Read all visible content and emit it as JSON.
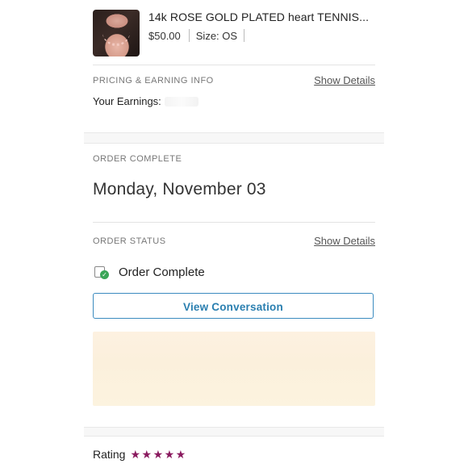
{
  "product": {
    "title": "14k ROSE GOLD PLATED heart TENNIS...",
    "price": "$50.00",
    "size": "Size: OS"
  },
  "pricing": {
    "section_label": "PRICING & EARNING INFO",
    "show_details": "Show Details",
    "earnings_label": "Your Earnings:"
  },
  "order_complete": {
    "section_label": "ORDER COMPLETE",
    "date": "Monday, November 03"
  },
  "order_status": {
    "section_label": "ORDER STATUS",
    "show_details": "Show Details",
    "status_text": "Order Complete",
    "view_conversation": "View Conversation"
  },
  "rating": {
    "label": "Rating",
    "stars": "★★★★★",
    "value": 5,
    "max": 5,
    "star_color": "#8a1a5f"
  },
  "colors": {
    "accent": "#2a7fb0",
    "status_green": "#3aa657"
  }
}
